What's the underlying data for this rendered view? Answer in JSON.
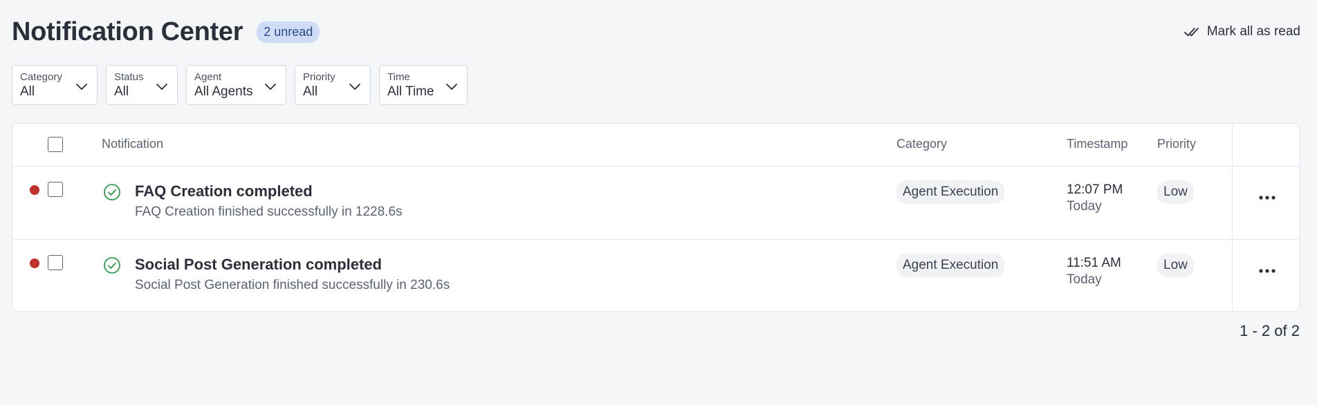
{
  "header": {
    "title": "Notification Center",
    "unread_badge": "2 unread",
    "mark_all_label": "Mark all as read"
  },
  "filters": [
    {
      "label": "Category",
      "value": "All"
    },
    {
      "label": "Status",
      "value": "All"
    },
    {
      "label": "Agent",
      "value": "All Agents"
    },
    {
      "label": "Priority",
      "value": "All"
    },
    {
      "label": "Time",
      "value": "All Time"
    }
  ],
  "table": {
    "columns": {
      "notification": "Notification",
      "category": "Category",
      "timestamp": "Timestamp",
      "priority": "Priority"
    },
    "rows": [
      {
        "title": "FAQ Creation completed",
        "description": "FAQ Creation finished successfully in 1228.6s",
        "category": "Agent Execution",
        "time": "12:07 PM",
        "day": "Today",
        "priority": "Low",
        "unread": true,
        "status_icon": "check-circle-icon"
      },
      {
        "title": "Social Post Generation completed",
        "description": "Social Post Generation finished successfully in 230.6s",
        "category": "Agent Execution",
        "time": "11:51 AM",
        "day": "Today",
        "priority": "Low",
        "unread": true,
        "status_icon": "check-circle-icon"
      }
    ]
  },
  "pagination": {
    "text": "1 - 2 of 2"
  },
  "colors": {
    "unread_dot": "#c0312b",
    "success_icon": "#2e9a4e",
    "badge_bg": "#cfdcf5",
    "badge_text": "#2c4a8a",
    "background": "#f5f6f8"
  }
}
